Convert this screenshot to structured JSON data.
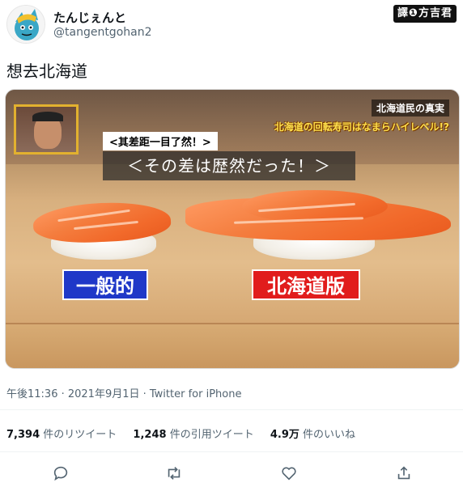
{
  "tweet": {
    "display_name": "たんじぇんと",
    "handle": "@tangentgohan2",
    "translator_badge": "譯❶方吉君",
    "text": "想去北海道",
    "timestamp": "午後11:36 · 2021年9月1日 · Twitter for iPhone"
  },
  "media": {
    "topic_line1": "北海道民の真実",
    "topic_line2": "北海道の回転寿司はなまらハイレベル!?",
    "chinese_subtitle": "<其差距一目了然！>",
    "japanese_subtitle": "＜その差は歴然だった！＞",
    "label_left": "一般的",
    "label_right": "北海道版"
  },
  "stats": {
    "retweets_count": "7,394",
    "retweets_label": "件のリツイート",
    "quotes_count": "1,248",
    "quotes_label": "件の引用ツイート",
    "likes_count": "4.9万",
    "likes_label": "件のいいね"
  },
  "actions": [
    "reply-icon",
    "retweet-icon",
    "like-icon",
    "share-icon"
  ]
}
